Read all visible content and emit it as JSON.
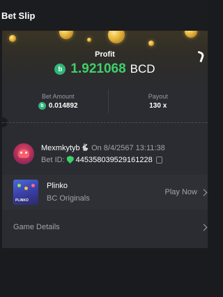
{
  "header": {
    "title": "Bet Slip"
  },
  "profit": {
    "label": "Profit",
    "value": "1.921068",
    "currency": "BCD",
    "currency_icon": "bcd-coin-icon",
    "value_color": "#3ed06b"
  },
  "bet_amount": {
    "label": "Bet Amount",
    "value": "0.014892"
  },
  "payout": {
    "label": "Payout",
    "value": "130 x"
  },
  "user": {
    "name": "Mexmkytyb",
    "badge": "🐇",
    "time": "On 8/4/2567 13:11:38",
    "bet_id_label": "Bet ID:",
    "bet_id": "445358039529161228"
  },
  "game": {
    "name": "Plinko",
    "provider": "BC Originals",
    "play_label": "Play Now",
    "thumb_text": "PLINKO"
  },
  "details": {
    "label": "Game Details"
  }
}
